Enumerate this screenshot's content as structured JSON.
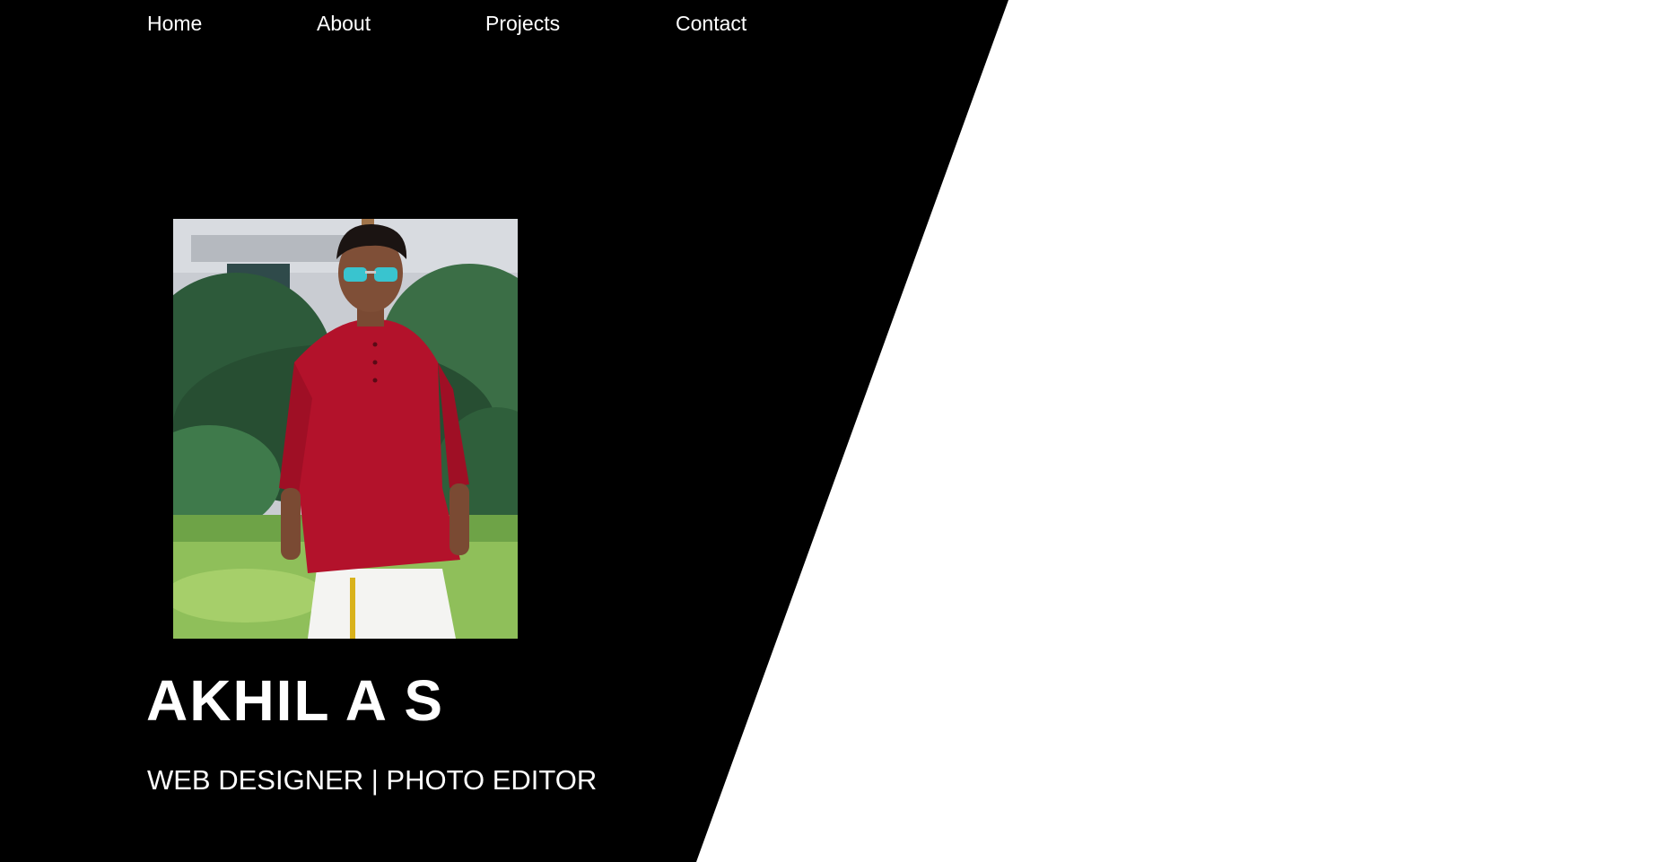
{
  "nav": {
    "items": [
      {
        "label": "Home"
      },
      {
        "label": "About"
      },
      {
        "label": "Projects"
      },
      {
        "label": "Contact"
      }
    ]
  },
  "hero": {
    "name": "AKHIL A S",
    "tagline": "WEB DESIGNER | PHOTO EDITOR"
  },
  "colors": {
    "background_dark": "#000000",
    "background_light": "#ffffff",
    "text": "#ffffff",
    "shirt": "#b3122b"
  }
}
